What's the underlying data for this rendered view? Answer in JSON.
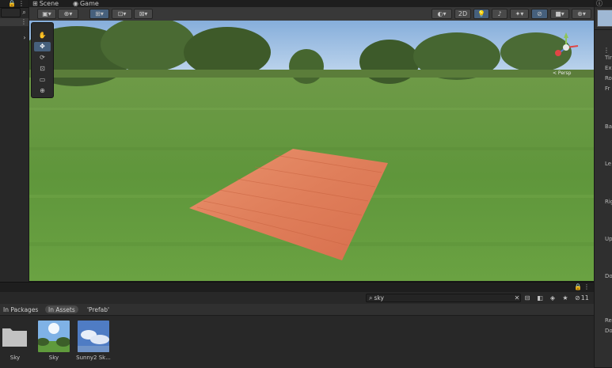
{
  "scene_tabs": [
    {
      "label": "Scene",
      "icon": "grid-icon"
    },
    {
      "label": "Game",
      "icon": "gamepad-icon"
    }
  ],
  "toolbar": {
    "mode_2d": "2D",
    "accent": "#46607c"
  },
  "scene_gizmo": {
    "label": "< Persp"
  },
  "inspector_labels": [
    "Tir",
    "Ex",
    "Ro",
    "Fr",
    "Ba",
    "Le",
    "Rig",
    "Up",
    "Do",
    "Re",
    "Do"
  ],
  "project": {
    "search_value": "sky",
    "filters": [
      "In Packages",
      "In Assets",
      "'Prefab'"
    ],
    "hidden_count": "11",
    "assets": [
      {
        "label": "Sky",
        "kind": "folder"
      },
      {
        "label": "Sky",
        "kind": "skybox-preview"
      },
      {
        "label": "Sunny2 Sk...",
        "kind": "skybox-preview"
      }
    ]
  }
}
